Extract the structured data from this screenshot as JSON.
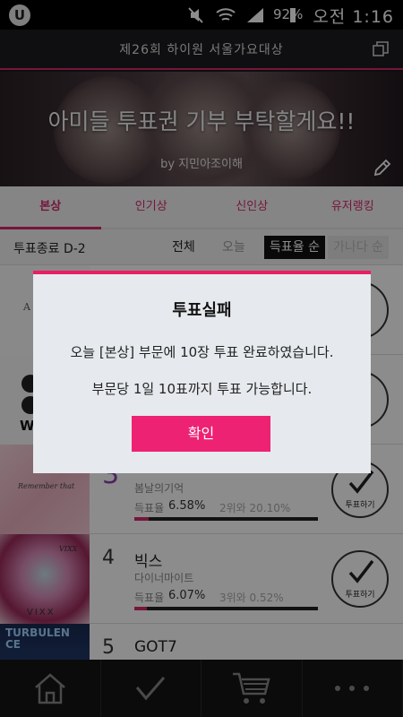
{
  "status_bar": {
    "battery": "92%",
    "time": "오전 1:16",
    "app_icon": "U"
  },
  "header": {
    "title": "제26회 하이원 서울가요대상"
  },
  "banner": {
    "message": "아미들 투표권 기부 부탁할게요!!",
    "author": "by 지민아조이해"
  },
  "tabs": [
    {
      "label": "본상",
      "active": true
    },
    {
      "label": "인기상",
      "active": false
    },
    {
      "label": "신인상",
      "active": false
    },
    {
      "label": "유저랭킹",
      "active": false
    }
  ],
  "sortbar": {
    "deadline": "투표종료 D-2",
    "sorts": [
      "전체",
      "오늘",
      "득표율 순",
      "가나다 순"
    ]
  },
  "list": [
    {
      "rank": "3",
      "name": "",
      "song": "봄날의기억",
      "rate_label": "득표율",
      "rate": "6.58%",
      "gap": "2위와 20.10%",
      "fill": 0.08,
      "vote_label": "투표하기"
    },
    {
      "rank": "4",
      "name": "빅스",
      "song": "다이너마이트",
      "rate_label": "득표율",
      "rate": "6.07%",
      "gap": "3위와 0.52%",
      "fill": 0.07,
      "vote_label": "투표하기"
    },
    {
      "rank": "5",
      "name": "GOT7",
      "song": "",
      "rate_label": "",
      "rate": "",
      "gap": "",
      "fill": 0,
      "vote_label": ""
    }
  ],
  "thumb_texts": {
    "remember": "Remember that",
    "vixx": "VIXX",
    "vixx_logo": "VIXX",
    "turbulence": "TURBULENCE",
    "a_letter": "A",
    "w_letter": "W"
  },
  "dialog": {
    "title": "투표실패",
    "message1": "오늘 [본상] 부문에 10장 투표 완료하였습니다.",
    "message2": "부문당 1일 10표까지 투표 가능합니다.",
    "confirm": "확인"
  },
  "colors": {
    "accent": "#e91e63",
    "dialog_bg": "#e6eaee"
  }
}
